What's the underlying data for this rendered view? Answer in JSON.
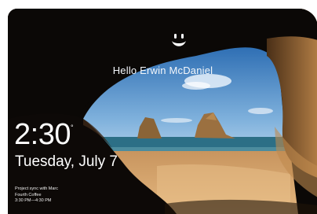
{
  "lock_screen": {
    "icon": "smiley-face-icon",
    "greeting": "Hello Erwin McDaniel",
    "time": "2:30",
    "time_suffix": "°",
    "date": "Tuesday, July 7",
    "event": {
      "title": "Project sync with Marc",
      "location": "Fourth Coffee",
      "time_range": "3:30 PM—4:30 PM"
    }
  },
  "colors": {
    "cave": "#0b0806",
    "sky_top": "#2f6fb4",
    "sky_bottom": "#9cc4e4",
    "sea": "#2c6f86",
    "sand": "#d9a56c",
    "rock": "#8a6437"
  }
}
